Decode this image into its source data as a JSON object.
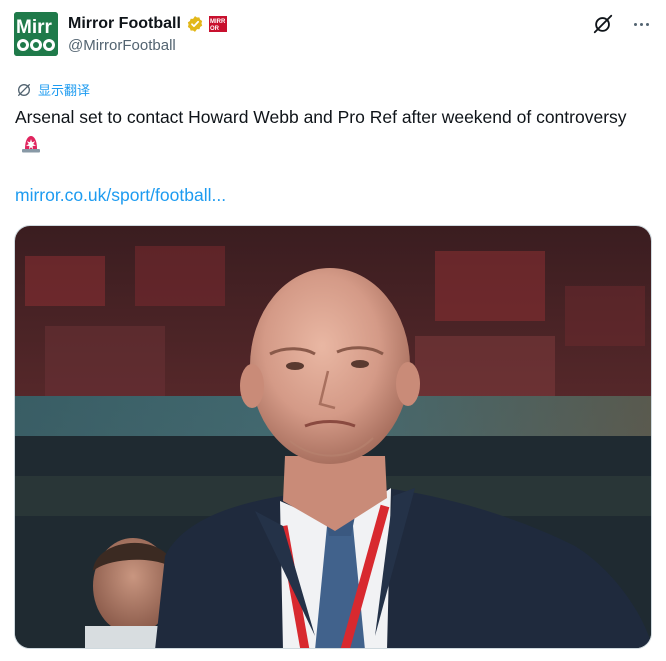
{
  "account": {
    "display_name": "Mirror Football",
    "handle": "@MirrorFootball",
    "avatar_text_top": "Mirr",
    "avatar_text_bottom": "OOO",
    "affiliate_badge_text": "MIRROR"
  },
  "tweet": {
    "translate_label": "显示翻译",
    "text": "Arsenal set to contact Howard Webb and Pro Ref after weekend of controversy",
    "link_text": "mirror.co.uk/sport/football..."
  },
  "icons": {
    "verified": "verified-badge-icon",
    "affiliate": "affiliate-badge-icon",
    "grok": "grok-icon",
    "more": "more-icon",
    "translate": "translate-icon",
    "siren": "rotating-light-emoji"
  },
  "colors": {
    "accent": "#1d9bf0",
    "verified_gold": "#e2b719",
    "avatar_bg": "#1f7a4a",
    "text_primary": "#0f1419",
    "text_secondary": "#536471"
  }
}
